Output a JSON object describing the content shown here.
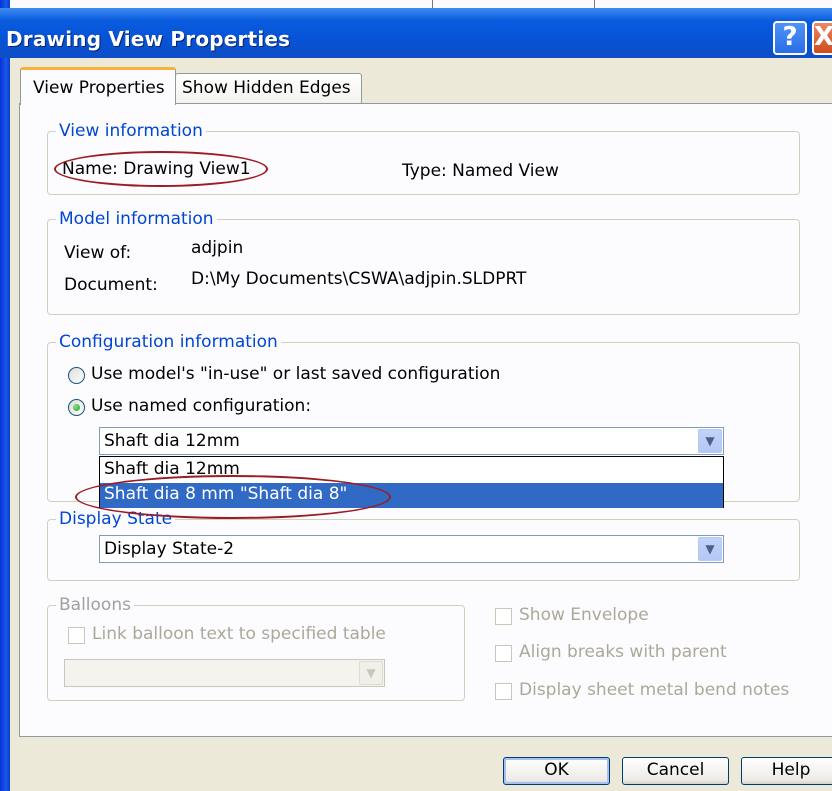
{
  "window": {
    "title": "Drawing View Properties",
    "help_glyph": "?",
    "close_glyph": "X"
  },
  "tabs": [
    {
      "label": "View Properties",
      "active": true
    },
    {
      "label": "Show Hidden Edges",
      "active": false
    }
  ],
  "view_information": {
    "legend": "View information",
    "name": "Name: Drawing View1",
    "type": "Type: Named View"
  },
  "model_information": {
    "legend": "Model information",
    "view_of_label": "View of:",
    "view_of_value": "adjpin",
    "document_label": "Document:",
    "document_value": "D:\\My Documents\\CSWA\\adjpin.SLDPRT"
  },
  "configuration_information": {
    "legend": "Configuration information",
    "option_in_use": "Use model's \"in-use\" or last saved configuration",
    "option_named": "Use named configuration:",
    "selected_option": "named",
    "combo_value": "Shaft dia 12mm",
    "dropdown_items": [
      "Shaft dia 12mm",
      "Shaft dia 8 mm \"Shaft dia 8\""
    ],
    "highlighted_index": 1
  },
  "display_state": {
    "legend": "Display State",
    "value": "Display State-2"
  },
  "balloons": {
    "legend": "Balloons",
    "link_label": "Link balloon text to specified table",
    "table_value": ""
  },
  "options": {
    "show_envelope": "Show Envelope",
    "align_breaks": "Align breaks with parent",
    "sheet_metal": "Display sheet metal bend notes"
  },
  "buttons": {
    "ok": "OK",
    "cancel": "Cancel",
    "help": "Help"
  },
  "colors": {
    "title_bar": "#0653d7",
    "group_legend": "#0046d5",
    "selection": "#316ac5",
    "annotation_ellipse": "#9c1c24",
    "dialog_bg": "#ece9d8"
  }
}
